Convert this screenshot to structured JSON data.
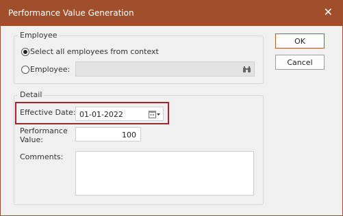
{
  "window": {
    "title": "Performance Value Generation"
  },
  "buttons": {
    "ok": "OK",
    "cancel": "Cancel"
  },
  "employee_group": {
    "legend": "Employee",
    "option_all_label": "Select all employees from context",
    "option_all_selected": true,
    "option_single_label": "Employee:",
    "employee_value": ""
  },
  "detail_group": {
    "legend": "Detail",
    "effective_date_label": "Effective Date:",
    "effective_date_value": "01-01-2022",
    "performance_label_line1": "Performance",
    "performance_label_line2": "Value:",
    "performance_value": "100",
    "comments_label": "Comments:",
    "comments_value": ""
  },
  "colors": {
    "title_bar": "#a14e2b",
    "highlight": "#a3262a"
  }
}
